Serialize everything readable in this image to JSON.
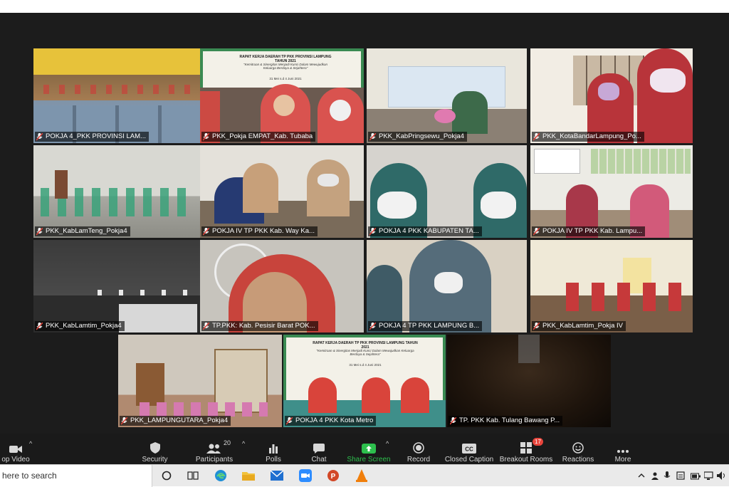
{
  "tiles": [
    {
      "name": "POKJA 4_PKK PROVINSI LAM...",
      "active": true
    },
    {
      "name": "PKK_Pokja EMPAT_Kab. Tubaba"
    },
    {
      "name": "PKK_KabPringsewu_Pokja4"
    },
    {
      "name": "PKK_KotaBandarLampung_Po..."
    },
    {
      "name": "PKK_KabLamTeng_Pokja4"
    },
    {
      "name": "POKJA IV TP PKK Kab. Way Ka..."
    },
    {
      "name": "POKJA 4 PKK KABUPATEN TA..."
    },
    {
      "name": "POKJA IV TP PKK Kab. Lampu..."
    },
    {
      "name": "PKK_KabLamtim_Pokja4"
    },
    {
      "name": "TP.PKK: Kab. Pesisir Barat POK..."
    },
    {
      "name": "POKJA 4 TP PKK LAMPUNG B..."
    },
    {
      "name": "PKK_KabLamtim_Pokja IV"
    },
    {
      "name": "PKK_LAMPUNGUTARA_Pokja4"
    },
    {
      "name": "POKJA 4 PKK Kota Metro"
    },
    {
      "name": "TP. PKK Kab. Tulang Bawang P..."
    }
  ],
  "banner": {
    "title": "RAPAT KERJA DAERAH TP PKK PROVINSI LAMPUNG TAHUN 2021",
    "subtitle": "\"Kemitraan & Sinergitas Menjadi Kunci Dalam Mewujudkan Keluarga Berdaya & Sejahtera\"",
    "dates": "31 Mei s.d 4 Juni 2021"
  },
  "toolbar": {
    "stop_video": "op Video",
    "security": "Security",
    "participants": "Participants",
    "participants_count": "20",
    "polls": "Polls",
    "chat": "Chat",
    "share_screen": "Share Screen",
    "record": "Record",
    "closed_caption": "Closed Caption",
    "breakout_rooms": "Breakout Rooms",
    "breakout_badge": "17",
    "reactions": "Reactions",
    "more": "More"
  },
  "taskbar": {
    "search_placeholder": "here to search"
  },
  "colors": {
    "meeting_bg": "#1c1c1c",
    "toolbar_bg": "#1a1a1a",
    "share_green": "#2dbf4d",
    "active_border": "#d9e46a",
    "mute_red": "#e0443b"
  }
}
